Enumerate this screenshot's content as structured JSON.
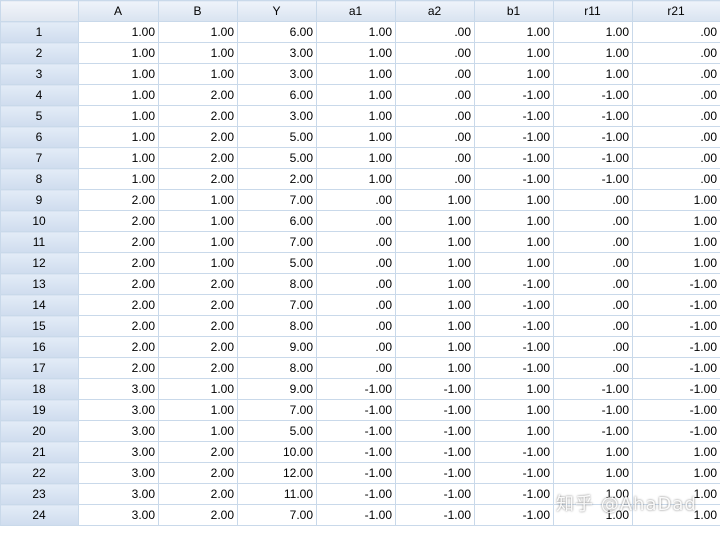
{
  "columns": [
    "A",
    "B",
    "Y",
    "a1",
    "a2",
    "b1",
    "r11",
    "r21"
  ],
  "rows": [
    {
      "id": "1",
      "cells": [
        "1.00",
        "1.00",
        "6.00",
        "1.00",
        ".00",
        "1.00",
        "1.00",
        ".00"
      ]
    },
    {
      "id": "2",
      "cells": [
        "1.00",
        "1.00",
        "3.00",
        "1.00",
        ".00",
        "1.00",
        "1.00",
        ".00"
      ]
    },
    {
      "id": "3",
      "cells": [
        "1.00",
        "1.00",
        "3.00",
        "1.00",
        ".00",
        "1.00",
        "1.00",
        ".00"
      ]
    },
    {
      "id": "4",
      "cells": [
        "1.00",
        "2.00",
        "6.00",
        "1.00",
        ".00",
        "-1.00",
        "-1.00",
        ".00"
      ]
    },
    {
      "id": "5",
      "cells": [
        "1.00",
        "2.00",
        "3.00",
        "1.00",
        ".00",
        "-1.00",
        "-1.00",
        ".00"
      ]
    },
    {
      "id": "6",
      "cells": [
        "1.00",
        "2.00",
        "5.00",
        "1.00",
        ".00",
        "-1.00",
        "-1.00",
        ".00"
      ]
    },
    {
      "id": "7",
      "cells": [
        "1.00",
        "2.00",
        "5.00",
        "1.00",
        ".00",
        "-1.00",
        "-1.00",
        ".00"
      ]
    },
    {
      "id": "8",
      "cells": [
        "1.00",
        "2.00",
        "2.00",
        "1.00",
        ".00",
        "-1.00",
        "-1.00",
        ".00"
      ]
    },
    {
      "id": "9",
      "cells": [
        "2.00",
        "1.00",
        "7.00",
        ".00",
        "1.00",
        "1.00",
        ".00",
        "1.00"
      ]
    },
    {
      "id": "10",
      "cells": [
        "2.00",
        "1.00",
        "6.00",
        ".00",
        "1.00",
        "1.00",
        ".00",
        "1.00"
      ]
    },
    {
      "id": "11",
      "cells": [
        "2.00",
        "1.00",
        "7.00",
        ".00",
        "1.00",
        "1.00",
        ".00",
        "1.00"
      ]
    },
    {
      "id": "12",
      "cells": [
        "2.00",
        "1.00",
        "5.00",
        ".00",
        "1.00",
        "1.00",
        ".00",
        "1.00"
      ]
    },
    {
      "id": "13",
      "cells": [
        "2.00",
        "2.00",
        "8.00",
        ".00",
        "1.00",
        "-1.00",
        ".00",
        "-1.00"
      ]
    },
    {
      "id": "14",
      "cells": [
        "2.00",
        "2.00",
        "7.00",
        ".00",
        "1.00",
        "-1.00",
        ".00",
        "-1.00"
      ]
    },
    {
      "id": "15",
      "cells": [
        "2.00",
        "2.00",
        "8.00",
        ".00",
        "1.00",
        "-1.00",
        ".00",
        "-1.00"
      ]
    },
    {
      "id": "16",
      "cells": [
        "2.00",
        "2.00",
        "9.00",
        ".00",
        "1.00",
        "-1.00",
        ".00",
        "-1.00"
      ]
    },
    {
      "id": "17",
      "cells": [
        "2.00",
        "2.00",
        "8.00",
        ".00",
        "1.00",
        "-1.00",
        ".00",
        "-1.00"
      ]
    },
    {
      "id": "18",
      "cells": [
        "3.00",
        "1.00",
        "9.00",
        "-1.00",
        "-1.00",
        "1.00",
        "-1.00",
        "-1.00"
      ]
    },
    {
      "id": "19",
      "cells": [
        "3.00",
        "1.00",
        "7.00",
        "-1.00",
        "-1.00",
        "1.00",
        "-1.00",
        "-1.00"
      ]
    },
    {
      "id": "20",
      "cells": [
        "3.00",
        "1.00",
        "5.00",
        "-1.00",
        "-1.00",
        "1.00",
        "-1.00",
        "-1.00"
      ]
    },
    {
      "id": "21",
      "cells": [
        "3.00",
        "2.00",
        "10.00",
        "-1.00",
        "-1.00",
        "-1.00",
        "1.00",
        "1.00"
      ]
    },
    {
      "id": "22",
      "cells": [
        "3.00",
        "2.00",
        "12.00",
        "-1.00",
        "-1.00",
        "-1.00",
        "1.00",
        "1.00"
      ]
    },
    {
      "id": "23",
      "cells": [
        "3.00",
        "2.00",
        "11.00",
        "-1.00",
        "-1.00",
        "-1.00",
        "1.00",
        "1.00"
      ]
    },
    {
      "id": "24",
      "cells": [
        "3.00",
        "2.00",
        "7.00",
        "-1.00",
        "-1.00",
        "-1.00",
        "1.00",
        "1.00"
      ]
    }
  ],
  "watermark": "知乎 @AhaDad",
  "colors": {
    "header_bg": "#dde6f2",
    "grid_line": "#c9d9ea",
    "cell_bg": "#ffffff"
  }
}
